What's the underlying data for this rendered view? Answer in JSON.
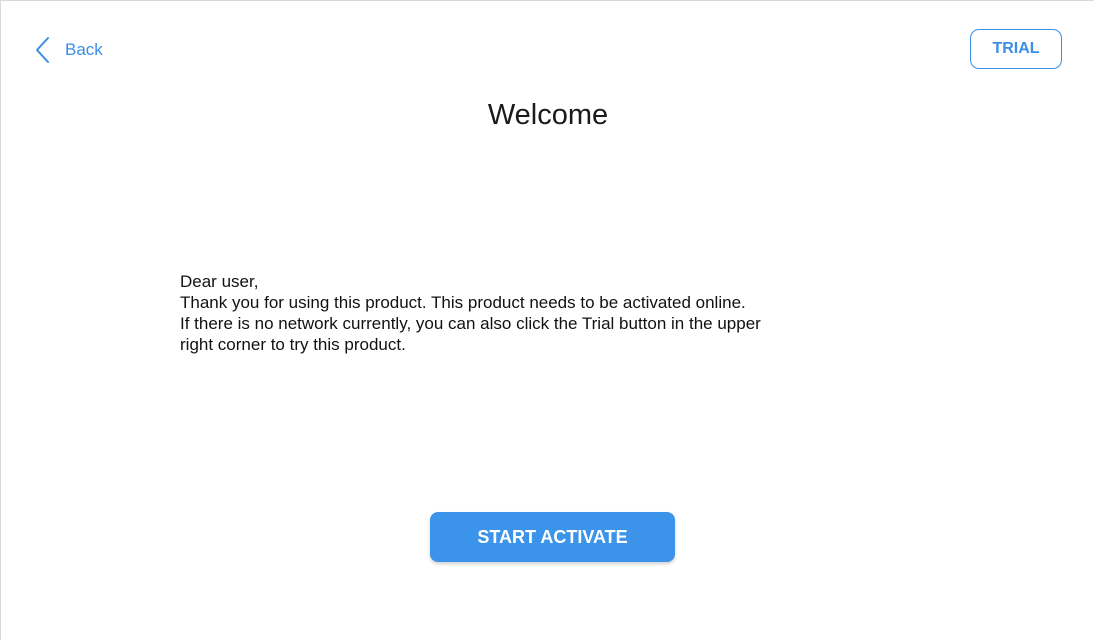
{
  "header": {
    "back_label": "Back",
    "trial_label": "TRIAL",
    "back_icon": "chevron-left-icon"
  },
  "main": {
    "title": "Welcome",
    "message_lines": [
      "Dear user,",
      "Thank you for using this product. This product needs to be activated online.",
      "If there is no network currently, you can also click the Trial button in the upper",
      "right corner to try this product."
    ],
    "activate_label": "START ACTIVATE"
  },
  "colors": {
    "accent": "#3a8ee6",
    "button_fill": "#3b93ea",
    "text": "#111111"
  }
}
